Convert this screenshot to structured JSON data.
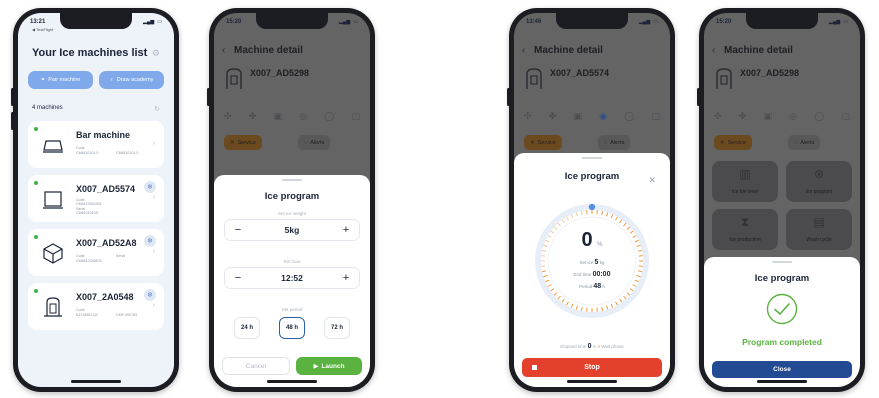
{
  "phones": {
    "list": {
      "time": "13:21",
      "forwarding": "◀ TestFlight",
      "title": "Your Ice machines list",
      "pair_label": "Pair machine",
      "academy_label": "Draw academy",
      "count": "4 machines",
      "machines": [
        {
          "name": "Bar machine",
          "meta1": "Code",
          "meta2": "CM6110101-0",
          "meta3": "CM6110101-0",
          "connected": true
        },
        {
          "name": "X007_AD5574",
          "meta1": "Code",
          "meta2": "CM6123304301",
          "meta3": "Serial",
          "meta4": "CM6101010S",
          "connected": true
        },
        {
          "name": "X007_AD52A8",
          "meta1": "Code",
          "meta2": "CM6612345678",
          "meta3": "Serial",
          "connected": true
        },
        {
          "name": "X007_2A0548",
          "meta1": "Code",
          "meta2": "EZ198DD-Q0",
          "meta3": "CMF-990783",
          "connected": true
        }
      ]
    },
    "program": {
      "time": "15:20",
      "bg_title": "Machine detail",
      "bg_machine": "X007_AD5298",
      "bg_service": "Service",
      "bg_alerts": "Alerts",
      "sheet_title": "Ice program",
      "weight_label": "Set ice weight",
      "weight_value": "5kg",
      "hour_label": "Set hour",
      "hour_value": "12:52",
      "period_label": "Set period",
      "periods": [
        "24 h",
        "48 h",
        "72 h"
      ],
      "selected_period_index": 1,
      "cancel_label": "Cancel",
      "launch_label": "Launch"
    },
    "running": {
      "time": "13:46",
      "bg_title": "Machine detail",
      "bg_machine": "X007_AD5574",
      "bg_service": "Service",
      "bg_alerts": "Alerts",
      "sheet_title": "Ice program",
      "percent": "0",
      "percent_unit": "%",
      "set_ice_label": "Set ice",
      "set_ice_value": "5",
      "set_ice_unit": "kg",
      "end_time_label": "End time",
      "end_time_value": "00:00",
      "period_label": "Period",
      "period_value": "48",
      "period_unit": "h",
      "elapsed_label": "Elapsed time",
      "elapsed_value": "0",
      "elapsed_unit": "m",
      "wait_label": "Wait phase",
      "stop_label": "Stop",
      "progress_fraction": 0.0
    },
    "completed": {
      "time": "15:20",
      "bg_title": "Machine detail",
      "bg_machine": "X007_AD5298",
      "bg_service": "Service",
      "bg_alerts": "Alerts",
      "tiles": [
        "Ice bin level",
        "Ice program",
        "Ice production",
        "Wash cycle"
      ],
      "sheet_title": "Ice program",
      "status": "Program completed",
      "close_label": "Close"
    }
  },
  "colors": {
    "accent_blue": "#2b5ea8",
    "pill_blue": "#7fa9ea",
    "success_green": "#5ab340",
    "stop_red": "#e4412c",
    "close_navy": "#224b93",
    "dial_orange": "#f39a3b"
  }
}
